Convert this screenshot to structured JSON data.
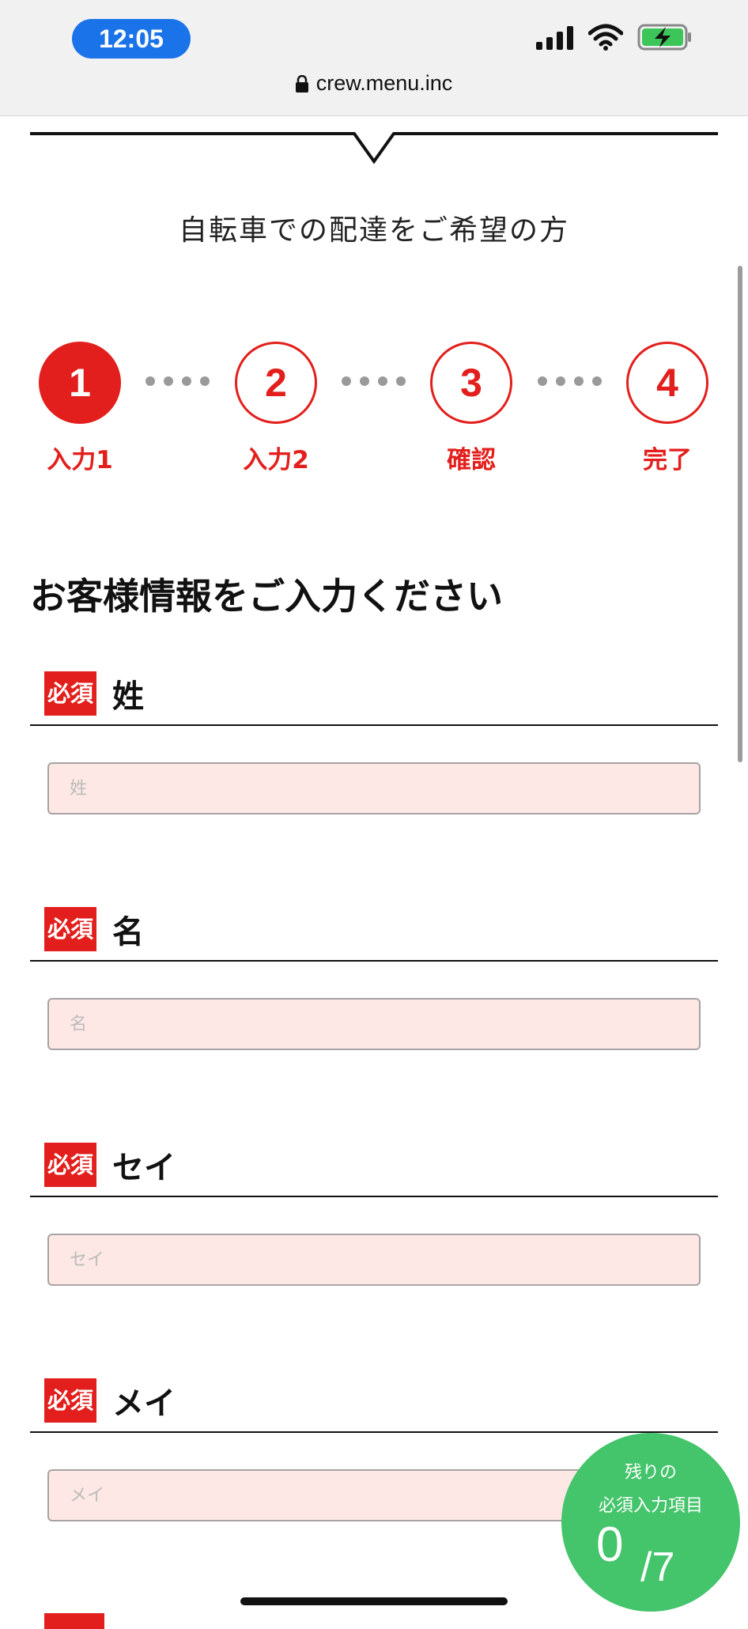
{
  "status_bar": {
    "time": "12:05",
    "url": "crew.menu.inc",
    "icons": [
      "signal-icon",
      "wifi-icon",
      "battery-charging-icon",
      "lock-icon"
    ]
  },
  "page": {
    "subtitle": "自転車での配達をご希望の方",
    "section_title": "お客様情報をご入力ください"
  },
  "stepper": {
    "steps": [
      {
        "number": "1",
        "label": "入力1",
        "active": true
      },
      {
        "number": "2",
        "label": "入力2",
        "active": false
      },
      {
        "number": "3",
        "label": "確認",
        "active": false
      },
      {
        "number": "4",
        "label": "完了",
        "active": false
      }
    ]
  },
  "form": {
    "required_badge": "必須",
    "fields": [
      {
        "label": "姓",
        "placeholder": "姓",
        "value": ""
      },
      {
        "label": "名",
        "placeholder": "名",
        "value": ""
      },
      {
        "label": "セイ",
        "placeholder": "セイ",
        "value": ""
      },
      {
        "label": "メイ",
        "placeholder": "メイ",
        "value": ""
      }
    ]
  },
  "remaining": {
    "line1": "残りの",
    "line2": "必須入力項目",
    "count": "0",
    "total": "/7"
  },
  "colors": {
    "brand_red": "#e21f1c",
    "input_bg": "#fde8e5",
    "badge_green": "#44c46b",
    "time_pill": "#1a73e8"
  }
}
